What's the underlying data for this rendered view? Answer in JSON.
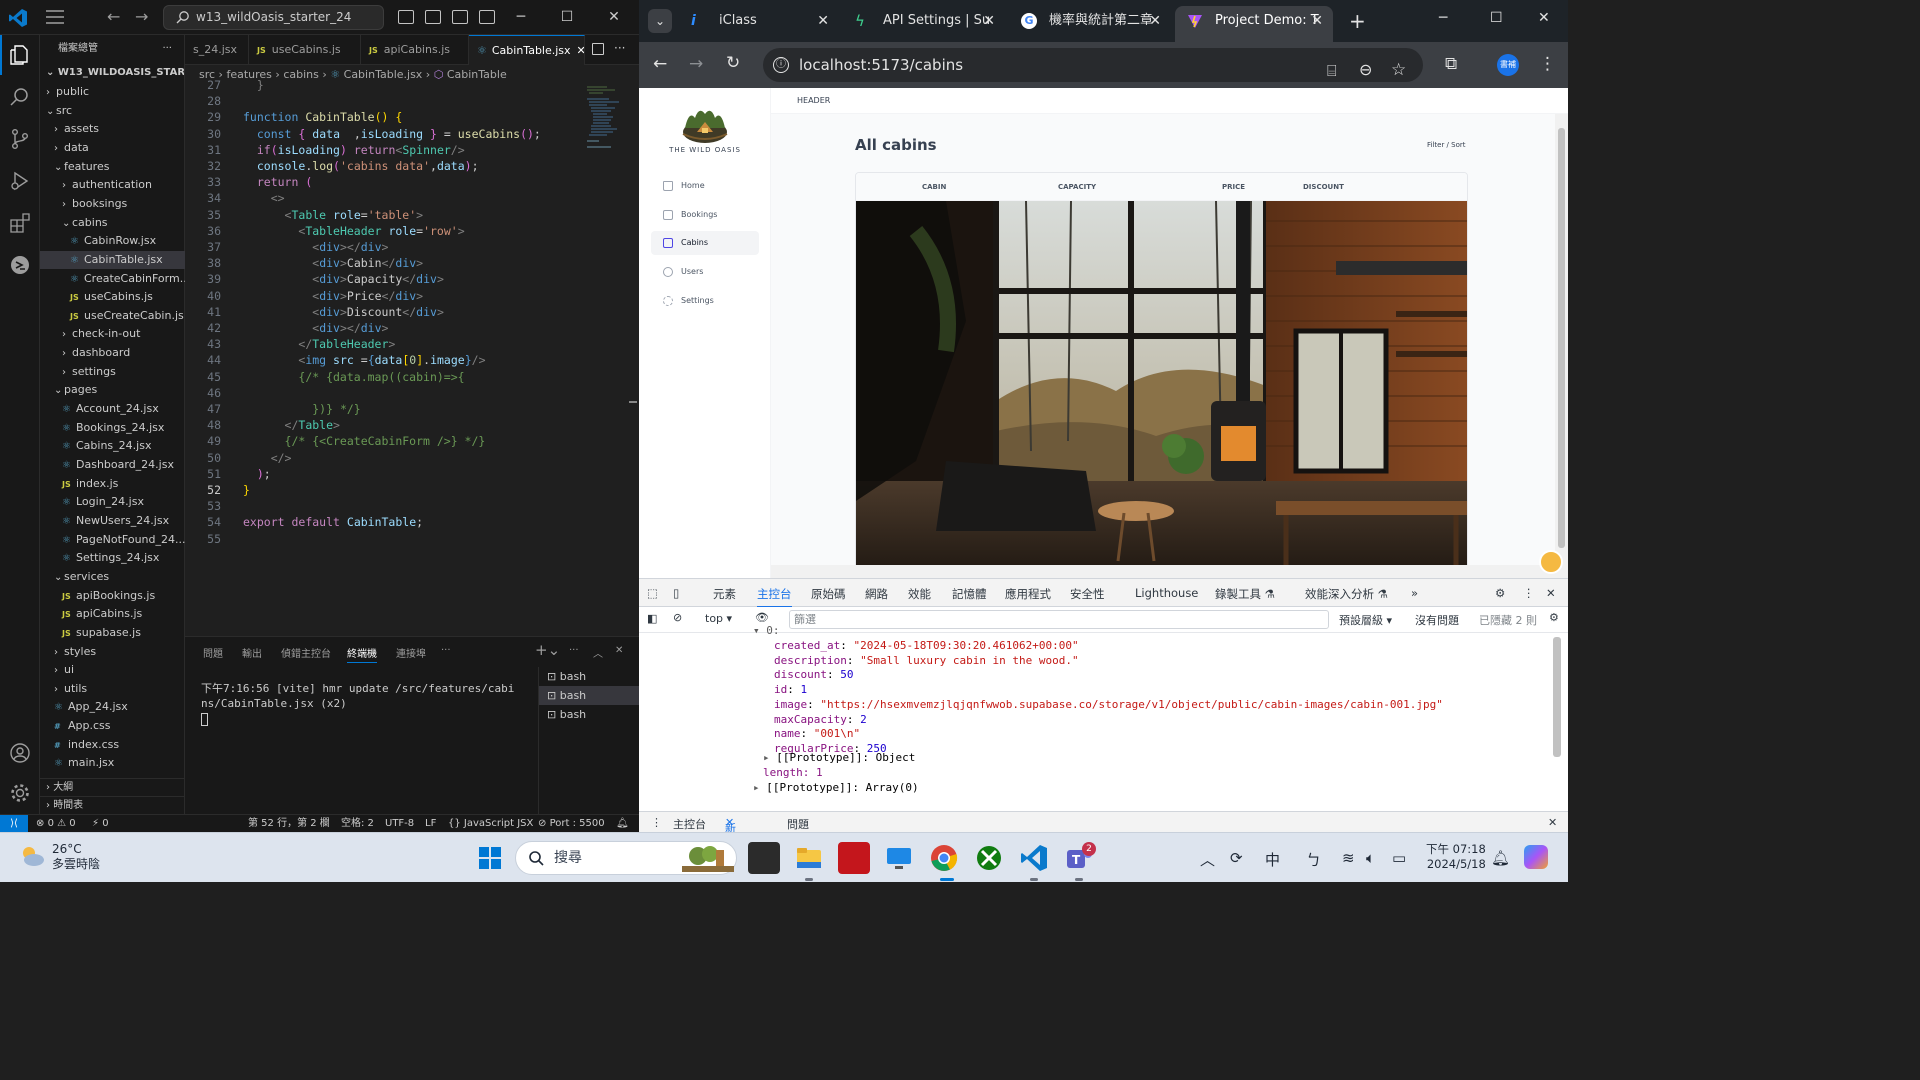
{
  "vscode": {
    "search_text": "w13_wildOasis_starter_24",
    "explorer_title": "檔案總管",
    "root_folder": "W13_WILDOASIS_STARTER...",
    "tree": [
      {
        "label": "public",
        "kind": "folder",
        "indent": 1,
        "open": false
      },
      {
        "label": "src",
        "kind": "folder",
        "indent": 1,
        "open": true
      },
      {
        "label": "assets",
        "kind": "folder",
        "indent": 2,
        "open": false
      },
      {
        "label": "data",
        "kind": "folder",
        "indent": 2,
        "open": false
      },
      {
        "label": "features",
        "kind": "folder",
        "indent": 2,
        "open": true
      },
      {
        "label": "authentication",
        "kind": "folder",
        "indent": 3,
        "open": false
      },
      {
        "label": "booksings",
        "kind": "folder",
        "indent": 3,
        "open": false
      },
      {
        "label": "cabins",
        "kind": "folder",
        "indent": 3,
        "open": true
      },
      {
        "label": "CabinRow.jsx",
        "kind": "jsx",
        "indent": 4
      },
      {
        "label": "CabinTable.jsx",
        "kind": "jsx",
        "indent": 4,
        "selected": true
      },
      {
        "label": "CreateCabinForm...",
        "kind": "jsx",
        "indent": 4
      },
      {
        "label": "useCabins.js",
        "kind": "js",
        "indent": 4
      },
      {
        "label": "useCreateCabin.js",
        "kind": "js",
        "indent": 4
      },
      {
        "label": "check-in-out",
        "kind": "folder",
        "indent": 3,
        "open": false
      },
      {
        "label": "dashboard",
        "kind": "folder",
        "indent": 3,
        "open": false
      },
      {
        "label": "settings",
        "kind": "folder",
        "indent": 3,
        "open": false
      },
      {
        "label": "pages",
        "kind": "folder",
        "indent": 2,
        "open": true
      },
      {
        "label": "Account_24.jsx",
        "kind": "jsx",
        "indent": 3
      },
      {
        "label": "Bookings_24.jsx",
        "kind": "jsx",
        "indent": 3
      },
      {
        "label": "Cabins_24.jsx",
        "kind": "jsx",
        "indent": 3
      },
      {
        "label": "Dashboard_24.jsx",
        "kind": "jsx",
        "indent": 3
      },
      {
        "label": "index.js",
        "kind": "js",
        "indent": 3
      },
      {
        "label": "Login_24.jsx",
        "kind": "jsx",
        "indent": 3
      },
      {
        "label": "NewUsers_24.jsx",
        "kind": "jsx",
        "indent": 3
      },
      {
        "label": "PageNotFound_24....",
        "kind": "jsx",
        "indent": 3
      },
      {
        "label": "Settings_24.jsx",
        "kind": "jsx",
        "indent": 3
      },
      {
        "label": "services",
        "kind": "folder",
        "indent": 2,
        "open": true
      },
      {
        "label": "apiBookings.js",
        "kind": "js",
        "indent": 3
      },
      {
        "label": "apiCabins.js",
        "kind": "js",
        "indent": 3
      },
      {
        "label": "supabase.js",
        "kind": "js",
        "indent": 3
      },
      {
        "label": "styles",
        "kind": "folder",
        "indent": 2,
        "open": false
      },
      {
        "label": "ui",
        "kind": "folder",
        "indent": 2,
        "open": false
      },
      {
        "label": "utils",
        "kind": "folder",
        "indent": 2,
        "open": false
      },
      {
        "label": "App_24.jsx",
        "kind": "jsx",
        "indent": 2
      },
      {
        "label": "App.css",
        "kind": "css",
        "indent": 2
      },
      {
        "label": "index.css",
        "kind": "css",
        "indent": 2
      },
      {
        "label": "main.jsx",
        "kind": "jsx",
        "indent": 2
      }
    ],
    "outline_label": "大綱",
    "timeline_label": "時間表",
    "tabs": [
      {
        "label": "s_24.jsx",
        "kind": "jsx"
      },
      {
        "label": "useCabins.js",
        "kind": "js"
      },
      {
        "label": "apiCabins.js",
        "kind": "js"
      },
      {
        "label": "CabinTable.jsx",
        "kind": "jsx",
        "active": true
      }
    ],
    "breadcrumbs": [
      "src",
      "features",
      "cabins",
      "CabinTable.jsx",
      "CabinTable"
    ],
    "line_numbers": [
      "27",
      "28",
      "29",
      "30",
      "31",
      "32",
      "33",
      "34",
      "35",
      "36",
      "37",
      "38",
      "39",
      "40",
      "41",
      "42",
      "43",
      "44",
      "45",
      "46",
      "47",
      "48",
      "49",
      "50",
      "51",
      "52",
      "53",
      "54",
      "55"
    ],
    "current_line": "52",
    "panel_tabs": [
      "問題",
      "輸出",
      "偵錯主控台",
      "終端機",
      "連接埠"
    ],
    "terminal_lines": [
      "下午7:16:56 [vite] hmr update /src/features/cabi",
      "ns/CabinTable.jsx (x2)"
    ],
    "terminal_list": [
      "bash",
      "bash",
      "bash"
    ],
    "status": {
      "errors": "0",
      "warnings": "0",
      "ports": "0",
      "position": "第 52 行，第 2 欄",
      "spaces": "空格: 2",
      "encoding": "UTF-8",
      "eol": "LF",
      "language": "JavaScript JSX",
      "live": "Port : 5500"
    }
  },
  "browser": {
    "tabs": [
      {
        "label": "iClass",
        "favicon_color": "#2d8cff"
      },
      {
        "label": "API Settings | Su",
        "favicon_color": "#3ecf8e"
      },
      {
        "label": "機率與統計第二章",
        "favicon_color": "#4285f4"
      },
      {
        "label": "Project Demo: T",
        "favicon_color": "#a855f7",
        "active": true
      }
    ],
    "url": "localhost:5173/cabins",
    "avatar_text": "書補"
  },
  "app": {
    "logo_text": "THE WILD OASIS",
    "header_text": "HEADER",
    "nav": [
      "Home",
      "Bookings",
      "Cabins",
      "Users",
      "Settings"
    ],
    "active_nav": "Cabins",
    "page_title": "All cabins",
    "filter_sort": "Filter / Sort",
    "columns": [
      "CABIN",
      "CAPACITY",
      "PRICE",
      "DISCOUNT"
    ]
  },
  "devtools": {
    "tabs": [
      "元素",
      "主控台",
      "原始碼",
      "網路",
      "效能",
      "記憶體",
      "應用程式",
      "安全性",
      "Lighthouse",
      "錄製工具 ⚗",
      "效能深入分析 ⚗"
    ],
    "active_tab": "主控台",
    "context": "top",
    "filter_placeholder": "篩選",
    "levels": "預設層級",
    "issues": "沒有問題",
    "hidden": "已隱藏 2 則",
    "object": [
      {
        "key": "created_at",
        "value": "\"2024-05-18T09:30:20.461062+00:00\"",
        "type": "string"
      },
      {
        "key": "description",
        "value": "\"Small luxury cabin in the wood.\"",
        "type": "string"
      },
      {
        "key": "discount",
        "value": "50",
        "type": "number"
      },
      {
        "key": "id",
        "value": "1",
        "type": "number"
      },
      {
        "key": "image",
        "value": "\"https://hsexmvemzjlqjqnfwwob.supabase.co/storage/v1/object/public/cabin-images/cabin-001.jpg\"",
        "type": "string"
      },
      {
        "key": "maxCapacity",
        "value": "2",
        "type": "number"
      },
      {
        "key": "name",
        "value": "\"001\\n\"",
        "type": "string"
      },
      {
        "key": "regularPrice",
        "value": "250",
        "type": "number"
      }
    ],
    "proto_object": "[[Prototype]]: Object",
    "length_line": "length: 1",
    "proto_array": "[[Prototype]]: Array(0)",
    "drawer_tabs": [
      "主控台",
      "新功能",
      "問題"
    ]
  },
  "taskbar": {
    "temperature": "26°C",
    "weather": "多雲時陰",
    "search_placeholder": "搜尋",
    "ime": "中",
    "time": "下午 07:18",
    "date": "2024/5/18",
    "teams_badge": "2"
  }
}
